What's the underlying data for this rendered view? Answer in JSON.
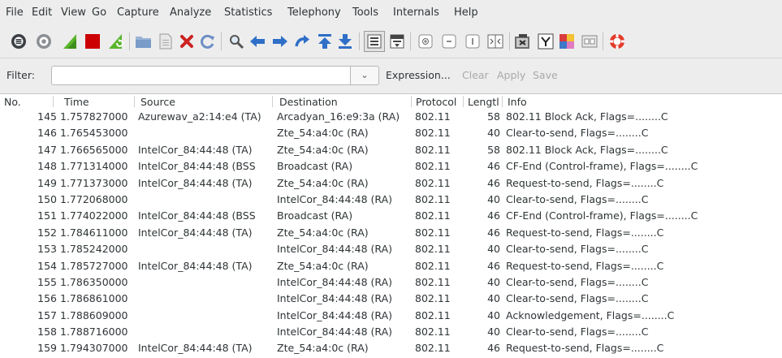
{
  "menu": [
    "File",
    "Edit",
    "View",
    "Go",
    "Capture",
    "Analyze",
    "Statistics",
    "Telephony",
    "Tools",
    "Internals",
    "Help"
  ],
  "toolbar": {
    "icons": [
      "capture-interfaces-icon",
      "capture-options-icon",
      "start-capture-icon",
      "stop-capture-icon",
      "restart-capture-icon",
      "open-file-icon",
      "save-file-icon",
      "close-file-icon",
      "reload-icon",
      "find-packet-icon",
      "go-back-icon",
      "go-forward-icon",
      "go-to-packet-icon",
      "go-first-icon",
      "go-last-icon",
      "colorize-icon",
      "autoscroll-icon",
      "zoom-in-icon",
      "zoom-out-icon",
      "normal-size-icon",
      "resize-columns-icon",
      "capture-filters-icon",
      "display-filters-icon",
      "coloring-rules-icon",
      "preferences-icon",
      "help-icon"
    ]
  },
  "filter": {
    "label": "Filter:",
    "value": "",
    "expression": "Expression...",
    "clear": "Clear",
    "apply": "Apply",
    "save": "Save"
  },
  "columns": [
    "No.",
    "Time",
    "Source",
    "Destination",
    "Protocol",
    "Lengtl",
    "Info"
  ],
  "packets": [
    {
      "no": "145",
      "time": "1.757827000",
      "src": "Azurewav_a2:14:e4 (TA)",
      "dst": "Arcadyan_16:e9:3a (RA)",
      "proto": "802.11",
      "len": "58",
      "info": "802.11 Block Ack, Flags=........C"
    },
    {
      "no": "146",
      "time": "1.765453000",
      "src": "",
      "dst": "Zte_54:a4:0c (RA)",
      "proto": "802.11",
      "len": "40",
      "info": "Clear-to-send, Flags=........C"
    },
    {
      "no": "147",
      "time": "1.766565000",
      "src": "IntelCor_84:44:48 (TA)",
      "dst": "Zte_54:a4:0c (RA)",
      "proto": "802.11",
      "len": "58",
      "info": "802.11 Block Ack, Flags=........C"
    },
    {
      "no": "148",
      "time": "1.771314000",
      "src": "IntelCor_84:44:48 (BSS",
      "dst": "Broadcast (RA)",
      "proto": "802.11",
      "len": "46",
      "info": "CF-End (Control-frame), Flags=........C"
    },
    {
      "no": "149",
      "time": "1.771373000",
      "src": "IntelCor_84:44:48 (TA)",
      "dst": "Zte_54:a4:0c (RA)",
      "proto": "802.11",
      "len": "46",
      "info": "Request-to-send, Flags=........C"
    },
    {
      "no": "150",
      "time": "1.772068000",
      "src": "",
      "dst": "IntelCor_84:44:48 (RA)",
      "proto": "802.11",
      "len": "40",
      "info": "Clear-to-send, Flags=........C"
    },
    {
      "no": "151",
      "time": "1.774022000",
      "src": "IntelCor_84:44:48 (BSS",
      "dst": "Broadcast (RA)",
      "proto": "802.11",
      "len": "46",
      "info": "CF-End (Control-frame), Flags=........C"
    },
    {
      "no": "152",
      "time": "1.784611000",
      "src": "IntelCor_84:44:48 (TA)",
      "dst": "Zte_54:a4:0c (RA)",
      "proto": "802.11",
      "len": "46",
      "info": "Request-to-send, Flags=........C"
    },
    {
      "no": "153",
      "time": "1.785242000",
      "src": "",
      "dst": "IntelCor_84:44:48 (RA)",
      "proto": "802.11",
      "len": "40",
      "info": "Clear-to-send, Flags=........C"
    },
    {
      "no": "154",
      "time": "1.785727000",
      "src": "IntelCor_84:44:48 (TA)",
      "dst": "Zte_54:a4:0c (RA)",
      "proto": "802.11",
      "len": "46",
      "info": "Request-to-send, Flags=........C"
    },
    {
      "no": "155",
      "time": "1.786350000",
      "src": "",
      "dst": "IntelCor_84:44:48 (RA)",
      "proto": "802.11",
      "len": "40",
      "info": "Clear-to-send, Flags=........C"
    },
    {
      "no": "156",
      "time": "1.786861000",
      "src": "",
      "dst": "IntelCor_84:44:48 (RA)",
      "proto": "802.11",
      "len": "40",
      "info": "Clear-to-send, Flags=........C"
    },
    {
      "no": "157",
      "time": "1.788609000",
      "src": "",
      "dst": "IntelCor_84:44:48 (RA)",
      "proto": "802.11",
      "len": "40",
      "info": "Acknowledgement, Flags=........C"
    },
    {
      "no": "158",
      "time": "1.788716000",
      "src": "",
      "dst": "IntelCor_84:44:48 (RA)",
      "proto": "802.11",
      "len": "40",
      "info": "Clear-to-send, Flags=........C"
    },
    {
      "no": "159",
      "time": "1.794307000",
      "src": "IntelCor_84:44:48 (TA)",
      "dst": "Zte_54:a4:0c (RA)",
      "proto": "802.11",
      "len": "46",
      "info": "Request-to-send, Flags=........C"
    }
  ],
  "colors": {
    "shark_blue": "#3a77c4",
    "stop_red": "#cc0000",
    "fin_green": "#5ab52d",
    "arrow_blue": "#2f6fc8"
  }
}
